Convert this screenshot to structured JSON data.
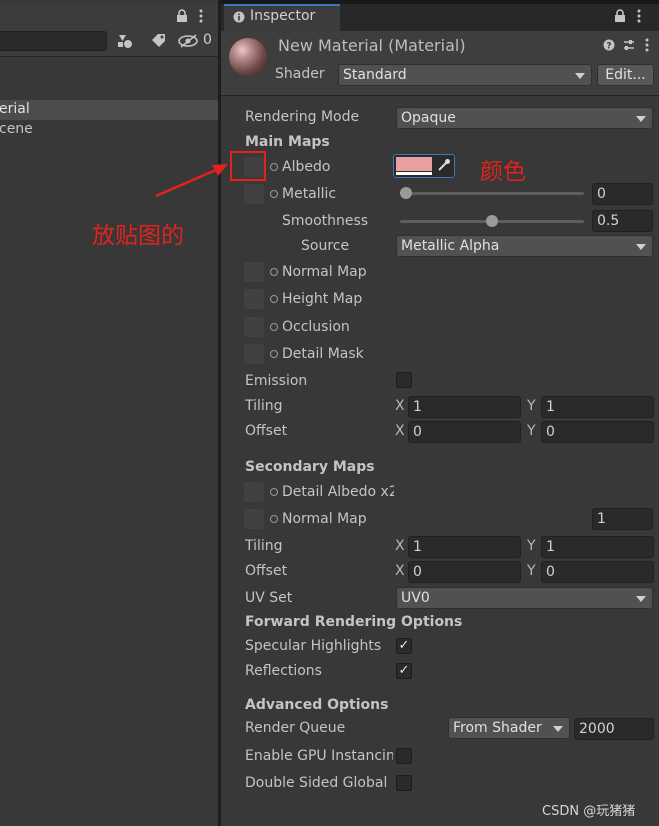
{
  "hierarchy": {
    "search_placeholder": "",
    "hidden_count": "0",
    "items": [
      "erial",
      "cene"
    ]
  },
  "inspector": {
    "tab_label": "Inspector",
    "material_title": "New Material (Material)",
    "shader_label": "Shader",
    "shader_value": "Standard",
    "edit_button": "Edit..."
  },
  "props": {
    "rendering_mode_label": "Rendering Mode",
    "rendering_mode_value": "Opaque",
    "main_maps": "Main Maps",
    "albedo": "Albedo",
    "albedo_color": "#e8a0a3",
    "metallic": "Metallic",
    "metallic_value": "0",
    "metallic_slider": 0.0,
    "smoothness": "Smoothness",
    "smoothness_value": "0.5",
    "smoothness_slider": 0.5,
    "source_label": "Source",
    "source_value": "Metallic Alpha",
    "normal_map": "Normal Map",
    "height_map": "Height Map",
    "occlusion": "Occlusion",
    "detail_mask": "Detail Mask",
    "emission": "Emission",
    "tiling": "Tiling",
    "offset": "Offset",
    "tiling_x": "1",
    "tiling_y": "1",
    "offset_x": "0",
    "offset_y": "0",
    "axis_x": "X",
    "axis_y": "Y"
  },
  "secondary": {
    "title": "Secondary Maps",
    "detail_albedo": "Detail Albedo x2",
    "normal_map": "Normal Map",
    "normal_value": "1",
    "tiling_x": "1",
    "tiling_y": "1",
    "offset_x": "0",
    "offset_y": "0",
    "uv_set_label": "UV Set",
    "uv_set_value": "UV0"
  },
  "forward": {
    "title": "Forward Rendering Options",
    "specular": "Specular Highlights",
    "reflections": "Reflections",
    "check": "✓"
  },
  "advanced": {
    "title": "Advanced Options",
    "render_queue": "Render Queue",
    "render_queue_mode": "From Shader",
    "render_queue_value": "2000",
    "gpu_instancing": "Enable GPU Instancing",
    "double_sided": "Double Sided Global Illumination"
  },
  "annotations": {
    "texture_note": "放贴图的",
    "color_note": "颜色",
    "accent": "#e0231c"
  },
  "watermark": "CSDN @玩猪猪"
}
